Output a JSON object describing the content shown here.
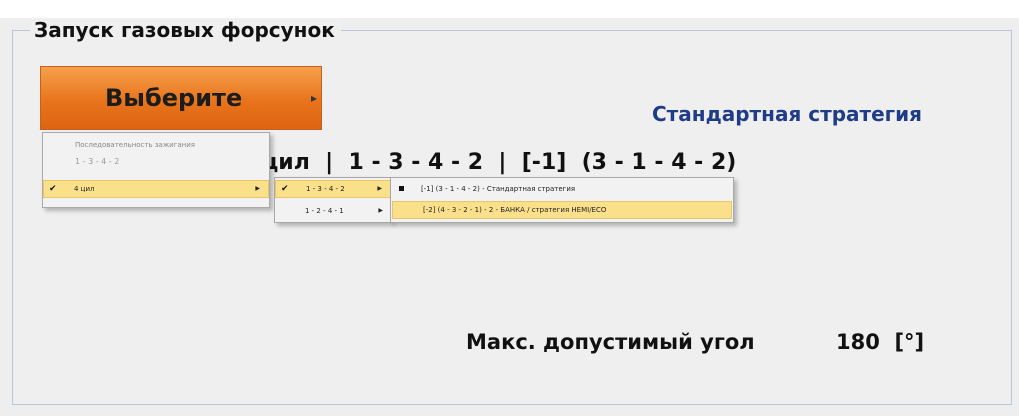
{
  "top_strip": {},
  "panel": {
    "title": "Запуск газовых форсунок",
    "select_button": {
      "label": "Выберите",
      "arrow": "▸"
    },
    "strategy_label": "Стандартная стратегия",
    "sequence_text": "цил  |  1 - 3 - 4 - 2  |  [-1]  (3 - 1 - 4 - 2)",
    "max_angle": {
      "label": "Макс. допустимый угол",
      "value": "180  [°]"
    }
  },
  "menu_level1": {
    "header": "Последовательность зажигания",
    "disabled_item": "1 - 3 - 4 - 2",
    "checked_item": {
      "check": "✔",
      "label": "4 цил",
      "submenu_arrow": "▶"
    }
  },
  "menu_level2": {
    "items": [
      {
        "check": "✔",
        "label": "1 - 3 - 4 - 2",
        "submenu_arrow": "▶"
      },
      {
        "check": "",
        "label": "1 - 2 - 4 - 1",
        "submenu_arrow": "▶"
      }
    ]
  },
  "menu_level3": {
    "items": [
      {
        "label": "[-1]  (3 - 1 - 4 - 2) - Стандартная стратегия",
        "selected": true
      },
      {
        "label": "[-2]  (4 - 3 - 2 - 1) - 2 - БАНКА / стратегия HEMI/ECO",
        "selected": false
      }
    ]
  }
}
